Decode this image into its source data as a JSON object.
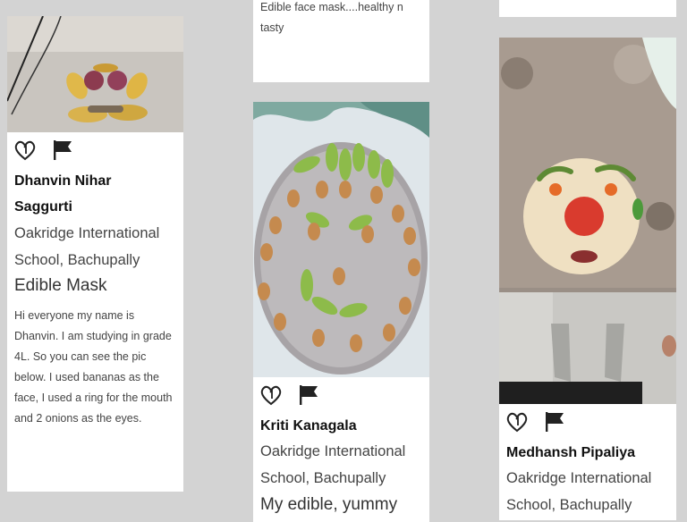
{
  "cards": [
    {
      "author": "Dhanvin Nihar Saggurti",
      "school": "Oakridge International School, Bachupally",
      "title": "Edible Mask",
      "description": "Hi everyone my name is Dhanvin.  I am studying in grade 4L. So you can see the pic below. I used bananas as the face, I used a ring for the mouth and 2 onions as the eyes."
    },
    {
      "top_text": "Edible face mask....healthy n tasty",
      "author": "Kriti Kanagala",
      "school": "Oakridge International School, Bachupally",
      "title": "My edible, yummy"
    },
    {
      "author": "Medhansh Pipaliya",
      "school": "Oakridge International School, Bachupally"
    }
  ],
  "icons": {
    "like": "heart-icon",
    "report": "flag-icon"
  },
  "colors": {
    "background": "#d3d3d3",
    "card": "#ffffff",
    "text": "#333333"
  }
}
